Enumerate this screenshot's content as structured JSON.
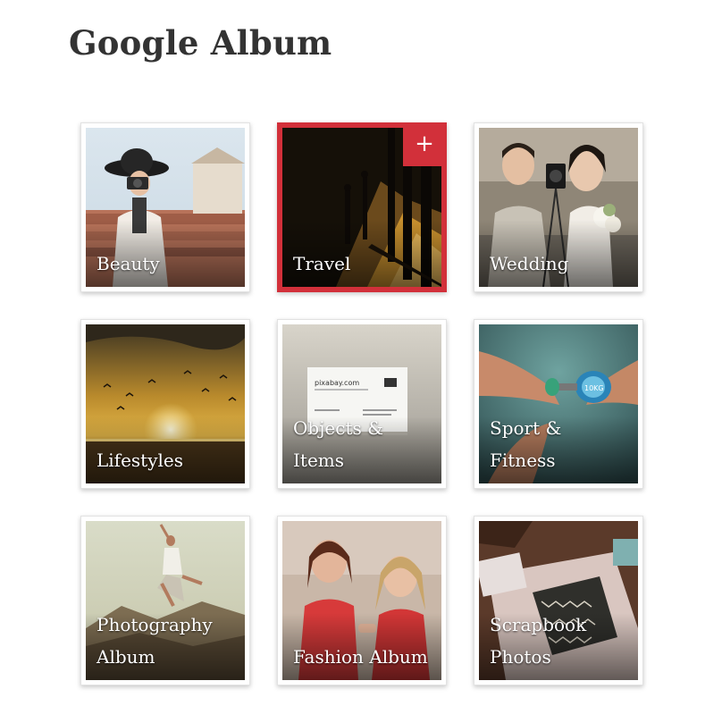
{
  "page": {
    "title": "Google Album"
  },
  "albums": [
    {
      "label": "Beauty"
    },
    {
      "label": "Travel",
      "add_icon": "+"
    },
    {
      "label": "Wedding"
    },
    {
      "label": "Lifestyles"
    },
    {
      "label": "Objects & Items"
    },
    {
      "label": "Sport & Fitness"
    },
    {
      "label": "Photography Album"
    },
    {
      "label": "Fashion Album"
    },
    {
      "label": "Scrapbook Photos"
    }
  ],
  "photo_details": {
    "objects_card_text": "pixabay.com",
    "sport_dumbbell_text": "10KG"
  },
  "colors": {
    "accent": "#d2303a",
    "title": "#333333"
  }
}
